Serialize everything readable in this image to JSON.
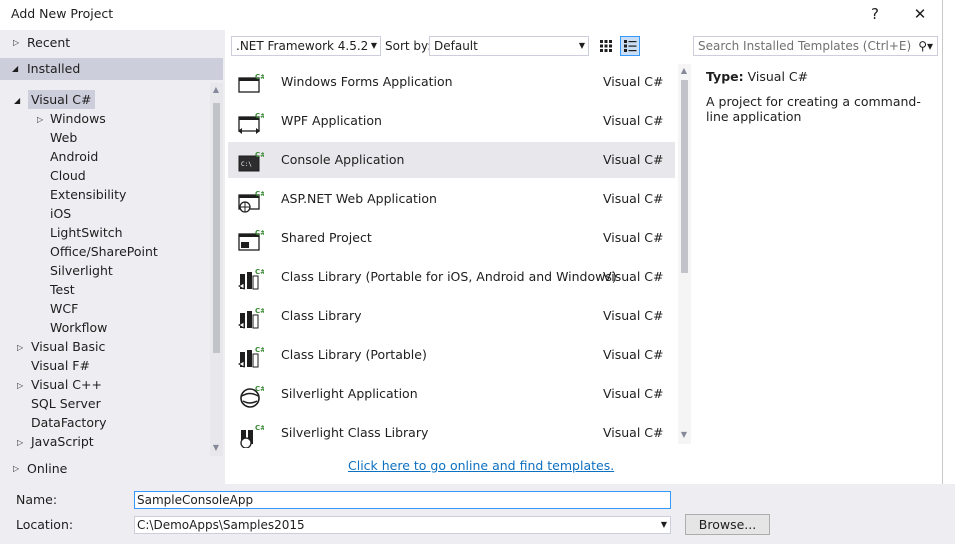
{
  "window": {
    "title": "Add New Project",
    "help_label": "?",
    "close_label": "✕"
  },
  "left_panel": {
    "recent": "Recent",
    "installed": "Installed",
    "online": "Online",
    "tree": [
      {
        "label": "Visual C#",
        "level": 0,
        "expander": "◢",
        "selected": true
      },
      {
        "label": "Windows",
        "level": 1,
        "expander": "▷"
      },
      {
        "label": "Web",
        "level": 1
      },
      {
        "label": "Android",
        "level": 1
      },
      {
        "label": "Cloud",
        "level": 1
      },
      {
        "label": "Extensibility",
        "level": 1
      },
      {
        "label": "iOS",
        "level": 1
      },
      {
        "label": "LightSwitch",
        "level": 1
      },
      {
        "label": "Office/SharePoint",
        "level": 1
      },
      {
        "label": "Silverlight",
        "level": 1
      },
      {
        "label": "Test",
        "level": 1
      },
      {
        "label": "WCF",
        "level": 1
      },
      {
        "label": "Workflow",
        "level": 1
      },
      {
        "label": "Visual Basic",
        "level": 0,
        "expander": "▷"
      },
      {
        "label": "Visual F#",
        "level": 0
      },
      {
        "label": "Visual C++",
        "level": 0,
        "expander": "▷"
      },
      {
        "label": "SQL Server",
        "level": 0
      },
      {
        "label": "DataFactory",
        "level": 0
      },
      {
        "label": "JavaScript",
        "level": 0,
        "expander": "▷"
      }
    ]
  },
  "toolbar": {
    "framework": ".NET Framework 4.5.2",
    "sort_label": "Sort by:",
    "sort_value": "Default",
    "search_placeholder": "Search Installed Templates (Ctrl+E)"
  },
  "templates": [
    {
      "name": "Windows Forms Application",
      "lang": "Visual C#",
      "icon": "windows-forms-icon"
    },
    {
      "name": "WPF Application",
      "lang": "Visual C#",
      "icon": "wpf-icon"
    },
    {
      "name": "Console Application",
      "lang": "Visual C#",
      "icon": "console-icon",
      "selected": true
    },
    {
      "name": "ASP.NET Web Application",
      "lang": "Visual C#",
      "icon": "web-app-icon"
    },
    {
      "name": "Shared Project",
      "lang": "Visual C#",
      "icon": "shared-project-icon"
    },
    {
      "name": "Class Library (Portable for iOS, Android and Windows)",
      "lang": "Visual C#",
      "icon": "class-library-icon"
    },
    {
      "name": "Class Library",
      "lang": "Visual C#",
      "icon": "class-library-icon"
    },
    {
      "name": "Class Library (Portable)",
      "lang": "Visual C#",
      "icon": "class-library-icon"
    },
    {
      "name": "Silverlight Application",
      "lang": "Visual C#",
      "icon": "silverlight-icon"
    },
    {
      "name": "Silverlight Class Library",
      "lang": "Visual C#",
      "icon": "silverlight-library-icon"
    }
  ],
  "online_link": "Click here to go online and find templates.",
  "details": {
    "type_label": "Type:",
    "type_value": "Visual C#",
    "description": "A project for creating a command-line application"
  },
  "form": {
    "name_label": "Name:",
    "name_value": "SampleConsoleApp",
    "location_label": "Location:",
    "location_value": "C:\\DemoApps\\Samples2015",
    "browse_label": "Browse..."
  },
  "colors": {
    "accent": "#3399ff",
    "link": "#0e70c0",
    "csharp_green": "#388a34",
    "panel_bg": "#eeeef2",
    "selected_bg": "#cccedb"
  }
}
